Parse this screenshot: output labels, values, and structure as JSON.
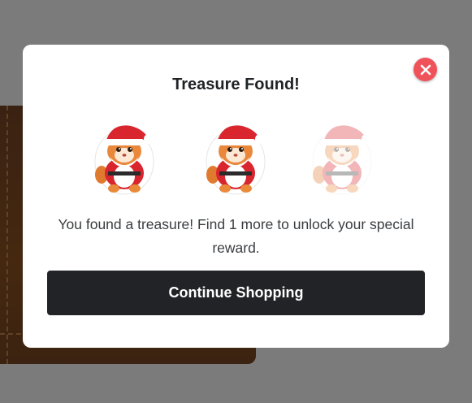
{
  "modal": {
    "title": "Treasure Found!",
    "message": "You found a treasure! Find 1 more to unlock your special reward.",
    "cta_label": "Continue Shopping",
    "close_icon": "close-icon"
  },
  "treasures": [
    {
      "icon": "santa-cat-icon",
      "found": true
    },
    {
      "icon": "santa-cat-icon",
      "found": true
    },
    {
      "icon": "santa-cat-icon",
      "found": false
    }
  ],
  "colors": {
    "close_button": "#f0525a",
    "cta_background": "#212326",
    "overlay": "#7b7b7b"
  }
}
